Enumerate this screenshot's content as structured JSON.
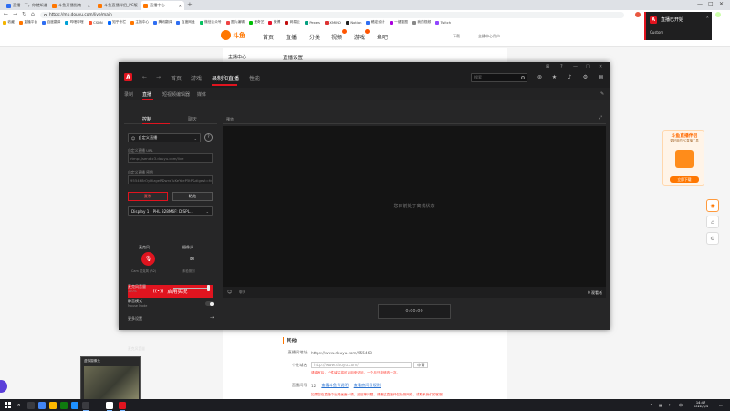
{
  "browser": {
    "tabs": [
      {
        "label": "直播一下，你就知道",
        "color": "#2f6ef2"
      },
      {
        "label": "斗鱼开播指南",
        "color": "#ff7700"
      },
      {
        "label": "斗鱼直播伴侣_PC版",
        "color": "#ff7700"
      },
      {
        "label": "直播中心",
        "color": "#ff7700",
        "active": true
      }
    ],
    "new_tab": "+",
    "url": "https://mp.douyu.com/live/main",
    "bookmarks": [
      {
        "label": "收藏",
        "color": "#f4b400"
      },
      {
        "label": "直播平台",
        "color": "#ff7700"
      },
      {
        "label": "百度翻译",
        "color": "#2f6ef2"
      },
      {
        "label": "哔哩哔哩",
        "color": "#00a1d6"
      },
      {
        "label": "CSDN",
        "color": "#fc5531"
      },
      {
        "label": "知乎专栏",
        "color": "#0066ff"
      },
      {
        "label": "主播中心",
        "color": "#ff7700"
      },
      {
        "label": "腾讯翻译",
        "color": "#2f6ef2"
      },
      {
        "label": "百度网盘",
        "color": "#2f6ef2"
      },
      {
        "label": "微信公众号",
        "color": "#07c160"
      },
      {
        "label": "图片编辑",
        "color": "#e44"
      },
      {
        "label": "爱奇艺",
        "color": "#00be06"
      },
      {
        "label": "微博",
        "color": "#e6162d"
      },
      {
        "label": "网易云",
        "color": "#c20c0c"
      },
      {
        "label": "Pexels",
        "color": "#05a081"
      },
      {
        "label": "XMIND",
        "color": "#d33"
      },
      {
        "label": "Notion",
        "color": "#222"
      },
      {
        "label": "稿定设计",
        "color": "#2f6ef2"
      },
      {
        "label": "一键抠图",
        "color": "#a0d"
      },
      {
        "label": "我的视频",
        "color": "#888"
      },
      {
        "label": "Twitch",
        "color": "#9146ff"
      }
    ]
  },
  "douyu": {
    "logo": "斗鱼",
    "nav": [
      "首页",
      "直播",
      "分类",
      "视频",
      "游戏",
      "鱼吧"
    ],
    "right_links": [
      "下载",
      "主播中心用户"
    ],
    "side_title": "主播中心",
    "main_title": "直播设置",
    "other_section": {
      "title": "其他",
      "room_addr_label": "直播间地址:",
      "room_addr_value": "https://www.douyu.com/955468",
      "personal_link_label": "个性域名:",
      "personal_link_value": "http://www.douyu.com/",
      "personal_link_btn": "申请",
      "personal_hint": "请填写后，个性域名将可以用来访问，一个月只能修改一次。",
      "room_number_label": "直播间号:",
      "room_number_value": "12",
      "room_number_link1": "查看斗鱼号说明",
      "room_number_link2": "查看房间号规则",
      "footer_note": "如果您在直播中出现画面卡顿、延迟等问题，请通过直播伴侣检测网络，或联系我们的客服。"
    },
    "promo": {
      "title": "斗鱼直播伴侣",
      "subtitle": "更好用的PC直播工具",
      "button": "立即下载"
    }
  },
  "app": {
    "logo_letter": "A",
    "nav_tabs": [
      {
        "label": "首页"
      },
      {
        "label": "游戏"
      },
      {
        "label": "录制和直播",
        "active": true
      },
      {
        "label": "性能"
      }
    ],
    "search_placeholder": "搜索",
    "sub_tabs": [
      {
        "label": "录制"
      },
      {
        "label": "直播",
        "active": true
      },
      {
        "label": "短视频编辑器"
      },
      {
        "label": "媒体"
      }
    ],
    "panel_tabs": [
      {
        "label": "控制",
        "active": true
      },
      {
        "label": "聊天"
      }
    ],
    "platform": "自定义直播",
    "help": "?",
    "server_label": "自定义直播 URL",
    "server_placeholder": "rtmp://sendtc3.douyu.com/live",
    "key_label": "自定义直播 密钥",
    "key_value": "955468rOyHlzgeRDwrxTuKeYoeP5tP&digest=fd9",
    "btn_copy": "复制",
    "btn_paste": "粘贴",
    "display_select": "Display 1 - PHL 328M6F: DISPL...",
    "go_live": "启用实况",
    "mic_label": "麦克风",
    "mic_sub": "Cam 麦克风 (R2)",
    "cam_label": "摄像头",
    "cam_sub": "未检测到",
    "mic_volume_label": "麦克风音量",
    "mic_volume_value": "100%",
    "mic_volume_fraction": 0.95,
    "mute_label": "静音模式",
    "mute_sub": "Mouse Mode",
    "more_settings": "更多设置",
    "preview_label": "预览",
    "preview_message": "您目前处于离线状态",
    "viewers": "0 观看者",
    "viewer_icon": "user-icon",
    "timer": "0:00:00",
    "win_controls": [
      "⊞",
      "?",
      "—",
      "□",
      "✕"
    ]
  },
  "notification": {
    "title": "直播已开始",
    "subtitle": "Custom"
  },
  "thumbnail": {
    "title": "虚拟摄像头"
  },
  "taskbar": {
    "time": "14:47",
    "date": "2022/3/3",
    "lang": "中",
    "apps": [
      "#4285f4",
      "#ffb900",
      "#0f7b0f",
      "#1e90ff",
      "#e0141f",
      "#ffffff",
      "#c33"
    ]
  }
}
